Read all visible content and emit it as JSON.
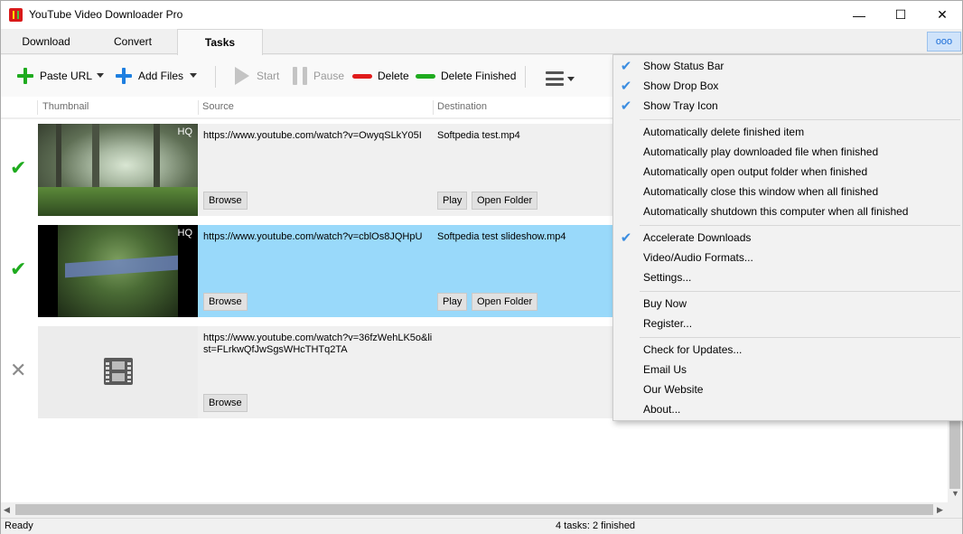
{
  "window": {
    "title": "YouTube Video Downloader Pro",
    "controls": {
      "minimize": "—",
      "maximize": "☐",
      "close": "✕"
    }
  },
  "tabs": [
    {
      "label": "Download"
    },
    {
      "label": "Convert"
    },
    {
      "label": "Tasks",
      "active": true
    }
  ],
  "more_button": {
    "label": "ooo"
  },
  "toolbar": {
    "paste_url": "Paste URL",
    "add_files": "Add Files",
    "start": "Start",
    "pause": "Pause",
    "delete": "Delete",
    "delete_finished": "Delete Finished",
    "colors": {
      "add": "#1fab1f",
      "add_files": "#1e7fe0",
      "delete": "#e01b1b",
      "delete_finished": "#1fab1f"
    }
  },
  "table": {
    "columns": [
      "Thumbnail",
      "Source",
      "Destination"
    ],
    "rows": [
      {
        "status": "✔",
        "hq": "HQ",
        "source": "https://www.youtube.com/watch?v=OwyqSLkY05I",
        "destination": "Softpedia test.mp4",
        "browse": "Browse",
        "play": "Play",
        "open_folder": "Open Folder"
      },
      {
        "status": "✔",
        "hq": "HQ",
        "source": "https://www.youtube.com/watch?v=cblOs8JQHpU",
        "destination": "Softpedia test slideshow.mp4",
        "browse": "Browse",
        "play": "Play",
        "open_folder": "Open Folder",
        "selected": true
      },
      {
        "status": "✕",
        "source": "https://www.youtube.com/watch?v=36fzWehLK5o&list=FLrkwQfJwSgsWHcTHTq2TA",
        "destination": "",
        "browse": "Browse"
      }
    ]
  },
  "statusbar": {
    "left": "Ready",
    "center": "4 tasks: 2 finished"
  },
  "menu": {
    "group1": [
      {
        "label": "Show Status Bar",
        "checked": true
      },
      {
        "label": "Show Drop Box",
        "checked": true
      },
      {
        "label": "Show Tray Icon",
        "checked": true
      }
    ],
    "group2": [
      {
        "label": "Automatically delete finished item"
      },
      {
        "label": "Automatically play downloaded file when finished"
      },
      {
        "label": "Automatically open output folder when finished"
      },
      {
        "label": "Automatically close this window when all finished"
      },
      {
        "label": "Automatically shutdown this computer when all finished"
      }
    ],
    "group3": [
      {
        "label": "Accelerate Downloads",
        "checked": true
      },
      {
        "label": "Video/Audio Formats..."
      },
      {
        "label": "Settings..."
      }
    ],
    "group4": [
      {
        "label": "Buy Now"
      },
      {
        "label": "Register..."
      }
    ],
    "group5": [
      {
        "label": "Check for Updates..."
      },
      {
        "label": "Email Us"
      },
      {
        "label": "Our Website"
      },
      {
        "label": "About..."
      }
    ],
    "check_glyph": "✔"
  }
}
